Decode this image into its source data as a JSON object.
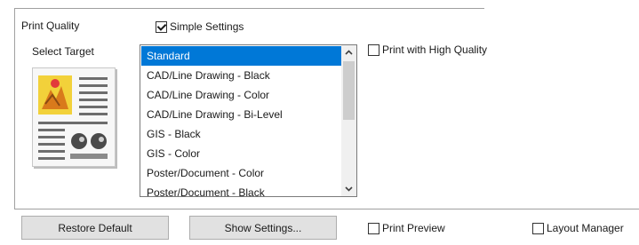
{
  "print_quality_label": "Print Quality",
  "simple_settings": {
    "label": "Simple Settings",
    "checked": true
  },
  "select_target_label": "Select Target",
  "targets": [
    {
      "label": "Standard",
      "selected": true
    },
    {
      "label": "CAD/Line Drawing - Black",
      "selected": false
    },
    {
      "label": "CAD/Line Drawing - Color",
      "selected": false
    },
    {
      "label": "CAD/Line Drawing - Bi-Level",
      "selected": false
    },
    {
      "label": "GIS - Black",
      "selected": false
    },
    {
      "label": "GIS - Color",
      "selected": false
    },
    {
      "label": "Poster/Document - Color",
      "selected": false
    },
    {
      "label": "Poster/Document - Black",
      "selected": false
    }
  ],
  "high_quality": {
    "label": "Print with High Quality",
    "checked": false
  },
  "buttons": {
    "restore_default": "Restore Default",
    "show_settings": "Show Settings..."
  },
  "print_preview": {
    "label": "Print Preview",
    "checked": false
  },
  "layout_manager": {
    "label": "Layout Manager",
    "checked": false
  },
  "colors": {
    "selection": "#0078d7",
    "button_face": "#e1e1e1"
  }
}
